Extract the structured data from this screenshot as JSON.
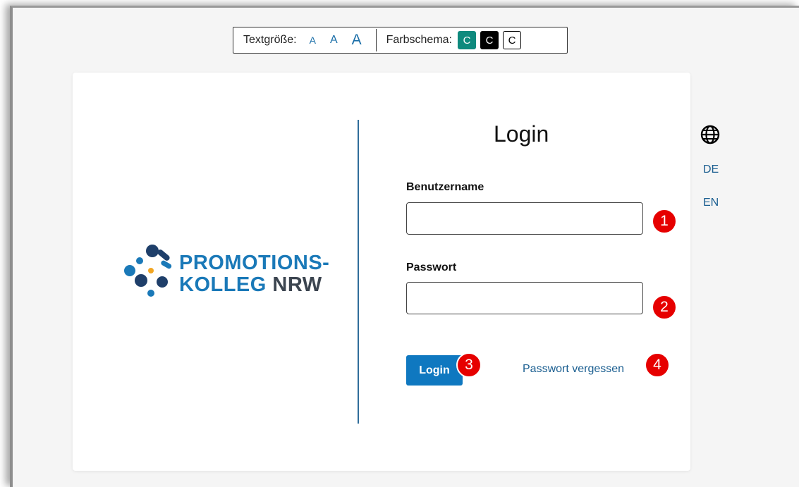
{
  "toolbar": {
    "text_size_label": "Textgröße:",
    "size_small": "A",
    "size_medium": "A",
    "size_large": "A",
    "color_scheme_label": "Farbschema:",
    "scheme_teal": "C",
    "scheme_black": "C",
    "scheme_white": "C"
  },
  "logo": {
    "line1": "PROMOTIONS-",
    "line2": "KOLLEG",
    "line2b": "NRW"
  },
  "login": {
    "title": "Login",
    "username_label": "Benutzername",
    "username_value": "",
    "password_label": "Passwort",
    "password_value": "",
    "submit_label": "Login",
    "forgot_label": "Passwort vergessen"
  },
  "language": {
    "de": "DE",
    "en": "EN"
  },
  "annotations": [
    "1",
    "2",
    "3",
    "4"
  ],
  "colors": {
    "accent": "#0f78c0",
    "link": "#1a5e90",
    "teal_scheme": "#0f8a7e",
    "badge": "#e60000",
    "divider": "#2f6d9a"
  }
}
